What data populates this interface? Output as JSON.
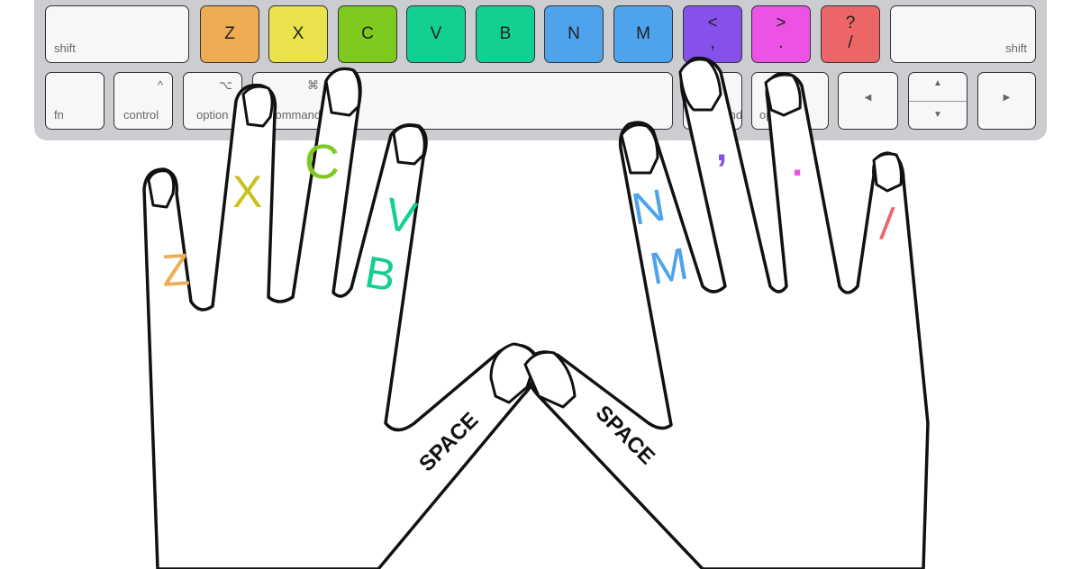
{
  "top_row": [
    {
      "label": "shift",
      "color": "#f7f7f8"
    },
    {
      "label": "Z",
      "color": "#eeac53"
    },
    {
      "label": "X",
      "color": "#eae34e"
    },
    {
      "label": "C",
      "color": "#7ec91e"
    },
    {
      "label": "V",
      "color": "#12cf92"
    },
    {
      "label": "B",
      "color": "#12cf92"
    },
    {
      "label": "N",
      "color": "#4ea3ec"
    },
    {
      "label": "M",
      "color": "#4ea3ec"
    },
    {
      "label": "<",
      "label2": ",",
      "color": "#8651ea"
    },
    {
      "label": ">",
      "label2": ".",
      "color": "#ec52e4"
    },
    {
      "label": "?",
      "label2": "/",
      "color": "#ec6668"
    },
    {
      "label": "shift",
      "color": "#f7f7f8"
    }
  ],
  "bottom_row": [
    {
      "label": "fn"
    },
    {
      "label": "control",
      "symbol": "^"
    },
    {
      "label": "option",
      "symbol": "⌥"
    },
    {
      "label": "command",
      "symbol": "⌘"
    },
    {
      "label": "command"
    },
    {
      "label": "option"
    },
    {
      "symbol": "◀"
    },
    {
      "symbol": "▲",
      "symbol2": "▼"
    },
    {
      "symbol": "▶"
    }
  ],
  "finger_labels": [
    {
      "text": "Z",
      "color": "#eeac53"
    },
    {
      "text": "X",
      "color": "#c9c21e"
    },
    {
      "text": "C",
      "color": "#7ec91e"
    },
    {
      "text": "V",
      "color": "#12cf92"
    },
    {
      "text": "B",
      "color": "#12cf92"
    },
    {
      "text": "N",
      "color": "#4ea3ec"
    },
    {
      "text": "M",
      "color": "#4ea3ec"
    },
    {
      "text": ",",
      "color": "#8651ea"
    },
    {
      "text": ".",
      "color": "#ec52e4"
    },
    {
      "text": "/",
      "color": "#ec6668"
    }
  ],
  "thumbs": {
    "left": "SPACE",
    "right": "SPACE"
  }
}
